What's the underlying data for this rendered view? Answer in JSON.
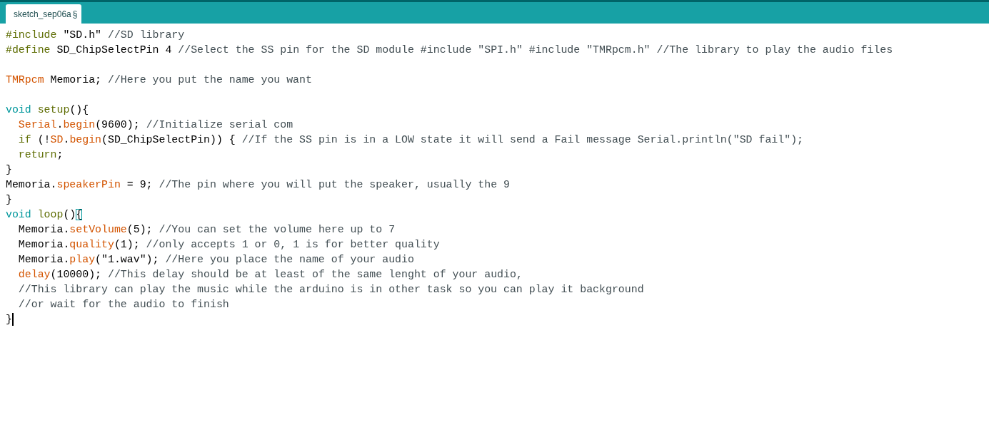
{
  "tabs": [
    {
      "label": "sketch_sep06a",
      "modified_mark": "§",
      "selected": true
    }
  ],
  "editor": {
    "lines": [
      {
        "kind": "code",
        "cursor": false,
        "tokens": [
          {
            "kind": "preproc",
            "text": "#include"
          },
          {
            "kind": "plain",
            "text": " \"SD.h\" "
          },
          {
            "kind": "comment",
            "text": "//SD library"
          }
        ]
      },
      {
        "kind": "code",
        "cursor": false,
        "tokens": [
          {
            "kind": "preproc",
            "text": "#define"
          },
          {
            "kind": "plain",
            "text": " SD_ChipSelectPin 4 "
          },
          {
            "kind": "comment",
            "text": "//Select the SS pin for the SD module #include \"SPI.h\" #include \"TMRpcm.h\" //The library to play the audio files"
          }
        ]
      },
      {
        "kind": "blank"
      },
      {
        "kind": "code",
        "cursor": false,
        "tokens": [
          {
            "kind": "type",
            "text": "TMRpcm"
          },
          {
            "kind": "plain",
            "text": " Memoria; "
          },
          {
            "kind": "comment",
            "text": "//Here you put the name you want"
          }
        ]
      },
      {
        "kind": "blank"
      },
      {
        "kind": "code",
        "cursor": false,
        "tokens": [
          {
            "kind": "keyword",
            "text": "void"
          },
          {
            "kind": "control",
            "text": " setup"
          },
          {
            "kind": "plain",
            "text": "(){"
          }
        ]
      },
      {
        "kind": "code",
        "cursor": false,
        "tokens": [
          {
            "kind": "type",
            "text": "  Serial"
          },
          {
            "kind": "plain",
            "text": "."
          },
          {
            "kind": "type",
            "text": "begin"
          },
          {
            "kind": "plain",
            "text": "(9600); "
          },
          {
            "kind": "comment",
            "text": "//Initialize serial com"
          }
        ]
      },
      {
        "kind": "code",
        "cursor": false,
        "tokens": [
          {
            "kind": "control",
            "text": "  if"
          },
          {
            "kind": "plain",
            "text": " (!"
          },
          {
            "kind": "type",
            "text": "SD"
          },
          {
            "kind": "plain",
            "text": "."
          },
          {
            "kind": "type",
            "text": "begin"
          },
          {
            "kind": "plain",
            "text": "(SD_ChipSelectPin)) { "
          },
          {
            "kind": "comment",
            "text": "//If the SS pin is in a LOW state it will send a Fail message Serial.println(\"SD fail\");"
          }
        ]
      },
      {
        "kind": "code",
        "cursor": false,
        "tokens": [
          {
            "kind": "control",
            "text": "  return"
          },
          {
            "kind": "plain",
            "text": ";"
          }
        ]
      },
      {
        "kind": "code",
        "cursor": false,
        "tokens": [
          {
            "kind": "plain",
            "text": "}"
          }
        ]
      },
      {
        "kind": "code",
        "cursor": false,
        "tokens": [
          {
            "kind": "plain",
            "text": "Memoria."
          },
          {
            "kind": "type",
            "text": "speakerPin"
          },
          {
            "kind": "plain",
            "text": " = 9; "
          },
          {
            "kind": "comment",
            "text": "//The pin where you will put the speaker, usually the 9"
          }
        ]
      },
      {
        "kind": "code",
        "cursor": false,
        "tokens": [
          {
            "kind": "plain",
            "text": "}"
          }
        ]
      },
      {
        "kind": "code",
        "cursor": false,
        "tokens": [
          {
            "kind": "keyword",
            "text": "void"
          },
          {
            "kind": "control",
            "text": " loop"
          },
          {
            "kind": "plain",
            "text": "()"
          },
          {
            "kind": "bracket_match",
            "text": "{"
          }
        ]
      },
      {
        "kind": "code",
        "cursor": false,
        "tokens": [
          {
            "kind": "plain",
            "text": "  Memoria."
          },
          {
            "kind": "type",
            "text": "setVolume"
          },
          {
            "kind": "plain",
            "text": "(5); "
          },
          {
            "kind": "comment",
            "text": "//You can set the volume here up to 7"
          }
        ]
      },
      {
        "kind": "code",
        "cursor": false,
        "tokens": [
          {
            "kind": "plain",
            "text": "  Memoria."
          },
          {
            "kind": "type",
            "text": "quality"
          },
          {
            "kind": "plain",
            "text": "(1); "
          },
          {
            "kind": "comment",
            "text": "//only accepts 1 or 0, 1 is for better quality"
          }
        ]
      },
      {
        "kind": "code",
        "cursor": false,
        "tokens": [
          {
            "kind": "plain",
            "text": "  Memoria."
          },
          {
            "kind": "type",
            "text": "play"
          },
          {
            "kind": "plain",
            "text": "(\"1.wav\"); "
          },
          {
            "kind": "comment",
            "text": "//Here you place the name of your audio"
          }
        ]
      },
      {
        "kind": "code",
        "cursor": false,
        "tokens": [
          {
            "kind": "type",
            "text": "  delay"
          },
          {
            "kind": "plain",
            "text": "(10000); "
          },
          {
            "kind": "comment",
            "text": "//This delay should be at least of the same lenght of your audio,"
          }
        ]
      },
      {
        "kind": "code",
        "cursor": false,
        "tokens": [
          {
            "kind": "comment",
            "text": "  //This library can play the music while the arduino is in other task so you can play it background"
          }
        ]
      },
      {
        "kind": "code",
        "cursor": false,
        "tokens": [
          {
            "kind": "comment",
            "text": "  //or wait for the audio to finish"
          }
        ]
      },
      {
        "kind": "code",
        "cursor": true,
        "tokens": [
          {
            "kind": "plain",
            "text": "}"
          }
        ]
      }
    ]
  }
}
